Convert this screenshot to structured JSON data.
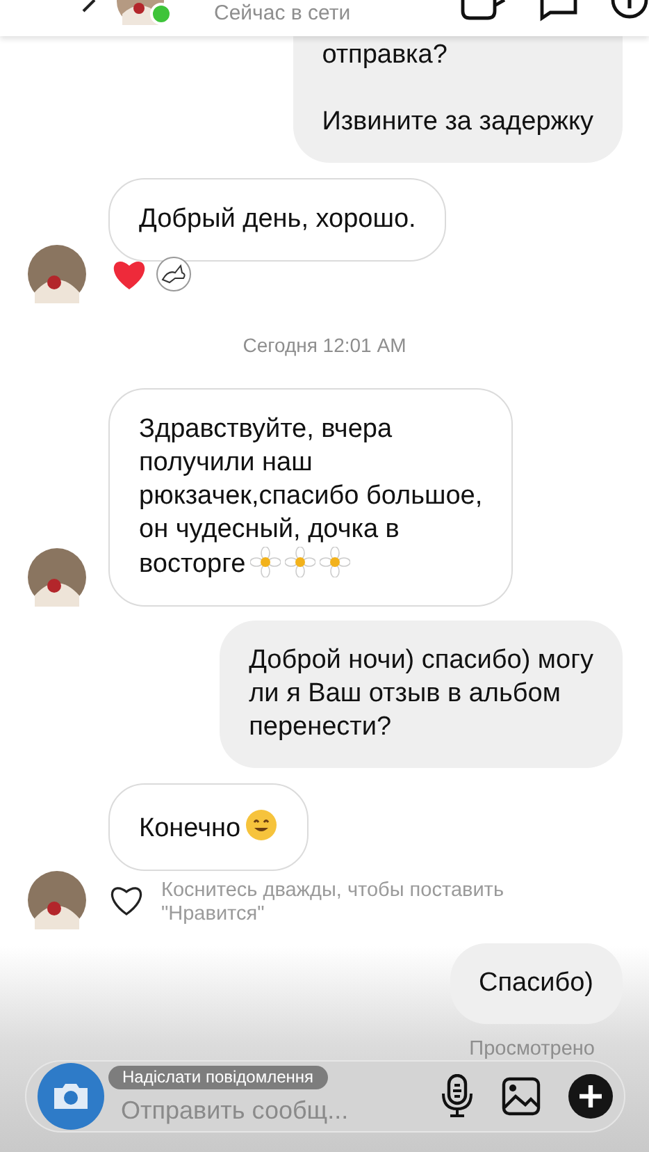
{
  "header": {
    "status": "Сейчас в сети",
    "online": true
  },
  "messages": [
    {
      "kind": "outgoing",
      "paragraphs": [
        [
          "отправка?"
        ],
        [
          "Извините за задержку"
        ]
      ],
      "cut_top": true
    },
    {
      "kind": "incoming",
      "lines": [
        "Добрый день, хорошо."
      ]
    },
    {
      "kind": "reactions",
      "items": [
        {
          "kind": "heart"
        },
        {
          "kind": "sticker"
        }
      ]
    },
    {
      "kind": "timestamp",
      "text": "Сегодня 12:01 AM"
    },
    {
      "kind": "incoming",
      "lines": [
        "Здравствуйте, вчера",
        "получили наш",
        "рюкзачек,спасибо большое,",
        "он чудесный, дочка в",
        "восторге"
      ],
      "emoji": [
        {
          "kind": "daisy"
        },
        {
          "kind": "daisy"
        },
        {
          "kind": "daisy"
        }
      ],
      "avatar": true
    },
    {
      "kind": "outgoing",
      "lines": [
        "Доброй ночи) спасибо) могу",
        "ли я Ваш отзыв в альбом",
        "перенести?"
      ]
    },
    {
      "kind": "incoming",
      "lines": [
        "Конечно"
      ],
      "emoji": [
        {
          "kind": "smile"
        }
      ]
    },
    {
      "kind": "like_hint",
      "text": "Коснитесь дважды, чтобы поставить \"Нравится\""
    },
    {
      "kind": "outgoing",
      "lines": [
        "Спасибо)"
      ]
    },
    {
      "kind": "seen",
      "text": "Просмотрено"
    }
  ],
  "composer": {
    "placeholder": "Отправить сообщ...",
    "overlay_text": "Надіслати повідомлення"
  }
}
